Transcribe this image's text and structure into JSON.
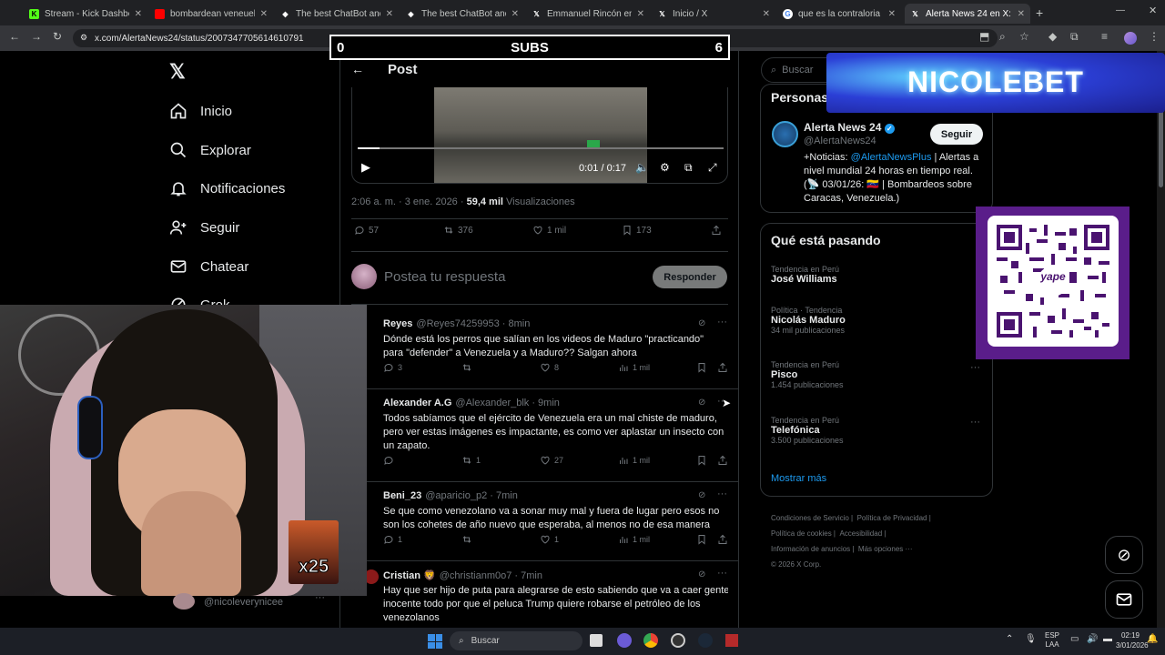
{
  "browser": {
    "tabs": [
      {
        "label": "Stream - Kick Dashboard",
        "color": "#53fc18"
      },
      {
        "label": "bombardean veneuela - Y",
        "color": "#ff0000"
      },
      {
        "label": "The best ChatBot and",
        "color": "#ffffff"
      },
      {
        "label": "The best ChatBot and Wi",
        "color": "#ffffff"
      },
      {
        "label": "Emmanuel Rincón en X: \"",
        "color": "#ffffff"
      },
      {
        "label": "Inicio / X",
        "color": "#ffffff"
      },
      {
        "label": "que es la contraloria - Bu",
        "color": "#ffffff"
      },
      {
        "label": "Alerta News 24 en X: \"¡e",
        "color": "#ffffff"
      }
    ],
    "url": "x.com/AlertaNews24/status/2007347705614610791"
  },
  "overlay": {
    "subs_label": "SUBS",
    "subs_left": "0",
    "subs_right": "6",
    "sponsor": "NICOLEBET",
    "sticker_label": "x25",
    "qr_label": "yape"
  },
  "nav": {
    "items": [
      "Inicio",
      "Explorar",
      "Notificaciones",
      "Seguir",
      "Chatear",
      "Grok"
    ],
    "account": "@nicoleverynicee"
  },
  "post": {
    "header_title": "Post",
    "video_time": "0:01 / 0:17",
    "video_progress": 0.06,
    "date": "2:06 a. m. · 3 ene. 2026 · ",
    "views_count": "59,4 mil",
    "views_label": "Visualizaciones",
    "replies": "57",
    "reposts": "376",
    "likes": "1 mil",
    "bookmarks": "173",
    "reply_placeholder": "Postea tu respuesta",
    "reply_button": "Responder"
  },
  "replies": [
    {
      "name": "Reyes",
      "handle": "@Reyes74259953 · 8min",
      "text": "Dónde está los perros que salían en los videos de Maduro \"practicando\" para \"defender\" a Venezuela y a Maduro?? Salgan ahora",
      "replies": "3",
      "reposts": "",
      "likes": "8",
      "views": "1 mil"
    },
    {
      "name": "Alexander A.G",
      "handle": "@Alexander_blk · 9min",
      "text": "Todos sabíamos que el ejército de Venezuela era un mal chiste de maduro, pero ver estas imágenes es impactante, es como ver aplastar un insecto con un zapato.",
      "replies": "",
      "reposts": "1",
      "likes": "27",
      "views": "1 mil"
    },
    {
      "name": "Beni_23",
      "handle": "@aparicio_p2 · 7min",
      "text": "Se que como venezolano va a sonar muy mal y fuera de lugar pero esos no son los cohetes de año nuevo que esperaba, al menos no de esa manera",
      "replies": "1",
      "reposts": "",
      "likes": "1",
      "views": "1 mil"
    },
    {
      "name": "Cristian 🦁",
      "handle": "@christianm0o7 · 7min",
      "text": "Hay que ser hijo de puta para alegrarse de esto sabiendo que va a caer gente inocente todo por que el peluca Trump quiere robarse el petróleo de los venezolanos",
      "replies": "",
      "reposts": "",
      "likes": "",
      "views": ""
    }
  ],
  "right": {
    "search_placeholder": "Buscar",
    "people_title": "Personas relevantes",
    "profile_name": "Alerta News 24",
    "profile_handle": "@AlertaNews24",
    "follow_button": "Seguir",
    "bio_prefix": "+Noticias: ",
    "bio_link": "@AlertaNewsPlus",
    "bio_rest": " | Alertas a nivel mundial 24 horas en tiempo real. (📡 03/01/26: 🇻🇪 | Bombardeos sobre Caracas, Venezuela.)",
    "trends_title": "Qué está pasando",
    "trends": [
      {
        "context": "Tendencia en Perú",
        "name": "José Williams",
        "count": ""
      },
      {
        "context": "Política · Tendencia",
        "name": "Nicolás Maduro",
        "count": "34 mil publicaciones"
      },
      {
        "context": "Tendencia en Perú",
        "name": "Pisco",
        "count": "1.454 publicaciones"
      },
      {
        "context": "Tendencia en Perú",
        "name": "Telefónica",
        "count": "3.500 publicaciones"
      }
    ],
    "show_more": "Mostrar más",
    "footer": [
      "Condiciones de Servicio",
      "Política de Privacidad",
      "Política de cookies",
      "Accesibilidad",
      "Información de anuncios",
      "Más opciones ···",
      "© 2026 X Corp."
    ]
  },
  "taskbar": {
    "search_placeholder": "Buscar",
    "lang": "ESP",
    "lang2": "LAA",
    "time": "02:19",
    "date": "3/01/2026"
  },
  "colors": {
    "accent": "#1d9bf0",
    "sponsor_bg": "#2b3fd6",
    "qr_frame": "#5a1d8a"
  }
}
